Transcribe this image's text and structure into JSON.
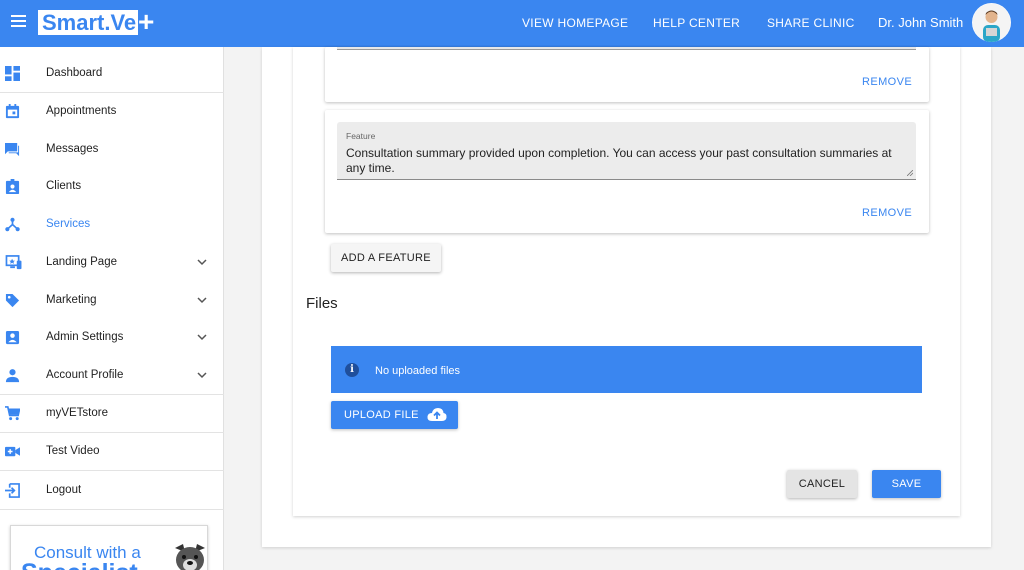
{
  "header": {
    "logo": "Smart.Ve",
    "logo_plus": "+",
    "nav": [
      "VIEW HOMEPAGE",
      "HELP CENTER",
      "SHARE CLINIC"
    ],
    "user_name": "Dr. John Smith"
  },
  "sidebar": {
    "items": [
      {
        "label": "Dashboard",
        "icon": "dashboard-icon"
      },
      {
        "label": "Appointments",
        "icon": "calendar-icon"
      },
      {
        "label": "Messages",
        "icon": "chat-icon"
      },
      {
        "label": "Clients",
        "icon": "badge-icon"
      },
      {
        "label": "Services",
        "icon": "services-icon",
        "active": true
      },
      {
        "label": "Landing Page",
        "icon": "monitor-icon",
        "expandable": true
      },
      {
        "label": "Marketing",
        "icon": "tag-icon",
        "expandable": true
      },
      {
        "label": "Admin Settings",
        "icon": "account-box-icon",
        "expandable": true
      },
      {
        "label": "Account Profile",
        "icon": "person-icon",
        "expandable": true
      },
      {
        "label": "myVETstore",
        "icon": "cart-icon"
      },
      {
        "label": "Test Video",
        "icon": "video-icon"
      },
      {
        "label": "Logout",
        "icon": "logout-icon"
      }
    ],
    "promo": {
      "line1": "Consult with a",
      "line2": "Specialist"
    }
  },
  "features": {
    "remove_label": "REMOVE",
    "feature_label": "Feature",
    "feature_value": "Consultation summary provided upon completion. You can access your past consultation summaries at any time.",
    "add_label": "ADD A FEATURE"
  },
  "files": {
    "title": "Files",
    "empty_message": "No uploaded files",
    "upload_label": "UPLOAD FILE"
  },
  "actions": {
    "cancel": "CANCEL",
    "save": "SAVE"
  },
  "colors": {
    "accent": "#3a86f0"
  }
}
